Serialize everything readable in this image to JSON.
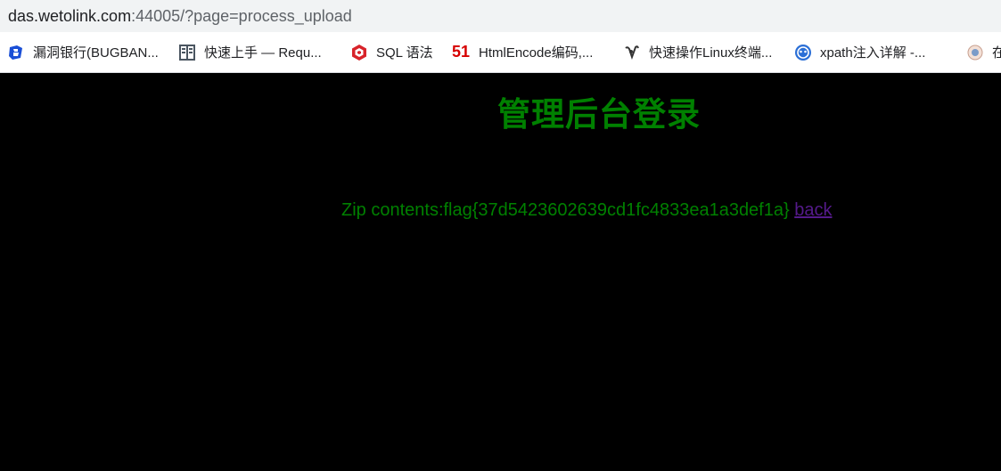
{
  "browser": {
    "url_host": "das.wetolink.com",
    "url_rest": ":44005/?page=process_upload"
  },
  "bookmarks": [
    {
      "label": "漏洞银行(BUGBAN...",
      "icon": "bugbank-icon"
    },
    {
      "label": "快速上手 — Requ...",
      "icon": "document-icon"
    },
    {
      "label": "SQL 语法",
      "icon": "sql-icon"
    },
    {
      "label": "HtmlEncode编码,...",
      "icon": "fiftyone-icon"
    },
    {
      "label": "快速操作Linux终端...",
      "icon": "linux-icon"
    },
    {
      "label": "xpath注入详解 -...",
      "icon": "xpath-icon"
    },
    {
      "label": "在",
      "icon": "globe-icon"
    }
  ],
  "bookmark_icon_text": {
    "fiftyone": "51"
  },
  "page": {
    "title": "管理后台登录",
    "result_prefix": "Zip contents:flag{37d5423602639cd1fc4833ea1a3def1a}",
    "back_label": "back"
  },
  "colors": {
    "text_green": "#008000",
    "link_visited": "#551a8b",
    "background": "#000000"
  }
}
